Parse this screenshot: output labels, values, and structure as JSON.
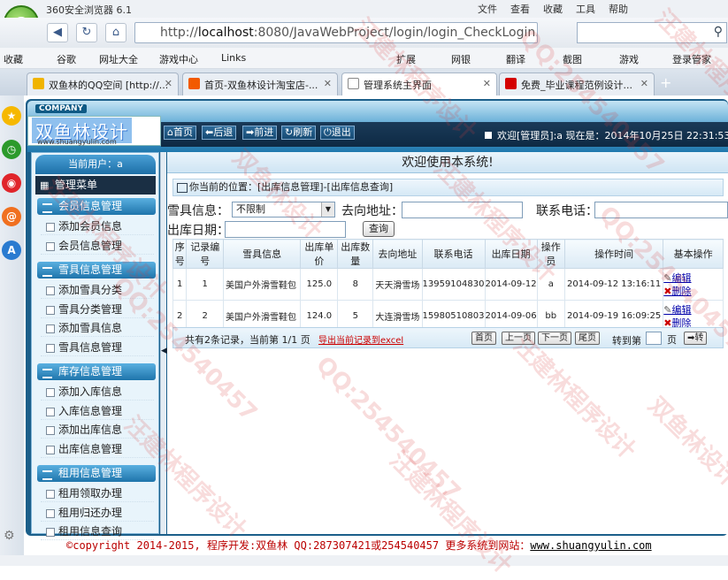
{
  "browser": {
    "title": "360安全浏览器 6.1",
    "menu": [
      "文件",
      "查看",
      "收藏",
      "工具",
      "帮助"
    ],
    "url_prefix": "http://",
    "url_host": "localhost",
    "url_rest": ":8080/JavaWebProject/login/login_CheckLogin.ac",
    "favorites": [
      "收藏",
      "谷歌",
      "网址大全",
      "游戏中心",
      "Links",
      "扩展",
      "网银",
      "翻译",
      "截图",
      "游戏",
      "登录管家"
    ],
    "tabs": [
      {
        "label": "双鱼林的QQ空间 [http://...",
        "color": "#f0b400"
      },
      {
        "label": "首页-双鱼林设计淘宝店-...",
        "color": "#f25a00"
      },
      {
        "label": "管理系统主界面",
        "color": "#ffffff"
      },
      {
        "label": "免费_毕业课程范例设计...",
        "color": "#d40000"
      }
    ]
  },
  "app": {
    "company": "COMPANY",
    "brand": "双鱼林设计",
    "brand_url": "www.shuangyulin.com",
    "nav": [
      "首页",
      "后退",
      "前进",
      "刷新",
      "退出"
    ],
    "welcome": "欢迎[管理员]:a  现在是：2014年10月25日 22:31:53",
    "current_user": "当前用户：a",
    "management_menu": "管理菜单",
    "menu_groups": [
      {
        "title": "会员信息管理",
        "items": [
          "添加会员信息",
          "会员信息管理"
        ]
      },
      {
        "title": "雪具信息管理",
        "items": [
          "添加雪具分类",
          "雪具分类管理",
          "添加雪具信息",
          "雪具信息管理"
        ]
      },
      {
        "title": "库存信息管理",
        "items": [
          "添加入库信息",
          "入库信息管理",
          "添加出库信息",
          "出库信息管理"
        ]
      },
      {
        "title": "租用信息管理",
        "items": [
          "租用领取办理",
          "租用归还办理",
          "租用信息查询"
        ]
      }
    ],
    "main_title": "欢迎使用本系统!",
    "location": "你当前的位置：[出库信息管理]-[出库信息查询]",
    "filters": {
      "equipment_label": "雪具信息：",
      "equipment_value": "不限制",
      "destination_label": "去向地址：",
      "phone_label": "联系电话：",
      "date_label": "出库日期：",
      "query_button": "查询"
    },
    "table": {
      "headers": [
        "序号",
        "记录编号",
        "雪具信息",
        "出库单价",
        "出库数量",
        "去向地址",
        "联系电话",
        "出库日期",
        "操作员",
        "操作时间",
        "基本操作"
      ],
      "rows": [
        [
          "1",
          "1",
          "美国户外滑雪鞋包",
          "125.0",
          "8",
          "天天滑雪场",
          "13959104830",
          "2014-09-12",
          "a",
          "2014-09-12 13:16:11"
        ],
        [
          "2",
          "2",
          "美国户外滑雪鞋包",
          "124.0",
          "5",
          "大连滑雪场",
          "15980510803",
          "2014-09-06",
          "bb",
          "2014-09-19 16:09:25"
        ]
      ],
      "edit_label": "编辑",
      "delete_label": "删除"
    },
    "pager": {
      "info": "共有2条记录，当前第 1/1 页",
      "export": "导出当前记录到excel",
      "first": "首页",
      "prev": "上一页",
      "next": "下一页",
      "last": "尾页",
      "goto_label": "转到第",
      "page_unit": "页",
      "go": "转"
    },
    "footer": {
      "copyright": "©copyright 2014-2015, 程序开发:双鱼林  QQ:287307421或254540457  更多系统到网站：",
      "site": "www.shuangyulin.com"
    },
    "watermark": [
      "汪建林程序设计",
      "QQ:254540457",
      "双鱼林设计"
    ]
  }
}
